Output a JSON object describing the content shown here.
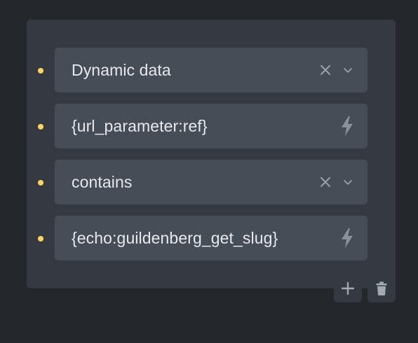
{
  "condition": {
    "rows": [
      {
        "kind": "select",
        "value": "Dynamic data",
        "clear_icon": "close-icon",
        "dropdown_icon": "chevron-down-icon"
      },
      {
        "kind": "dynamic-input",
        "value": "{url_parameter:ref}",
        "action_icon": "bolt-icon"
      },
      {
        "kind": "select",
        "value": "contains",
        "clear_icon": "close-icon",
        "dropdown_icon": "chevron-down-icon"
      },
      {
        "kind": "dynamic-input",
        "value": "{echo:guildenberg_get_slug}",
        "action_icon": "bolt-icon"
      }
    ]
  },
  "actions": {
    "add_icon": "plus-icon",
    "delete_icon": "trash-icon"
  },
  "colors": {
    "background": "#24272c",
    "panel": "#353a42",
    "field": "#474d57",
    "text": "#e6e8ec",
    "icon": "#9aa0aa",
    "bullet": "#f5d462"
  }
}
